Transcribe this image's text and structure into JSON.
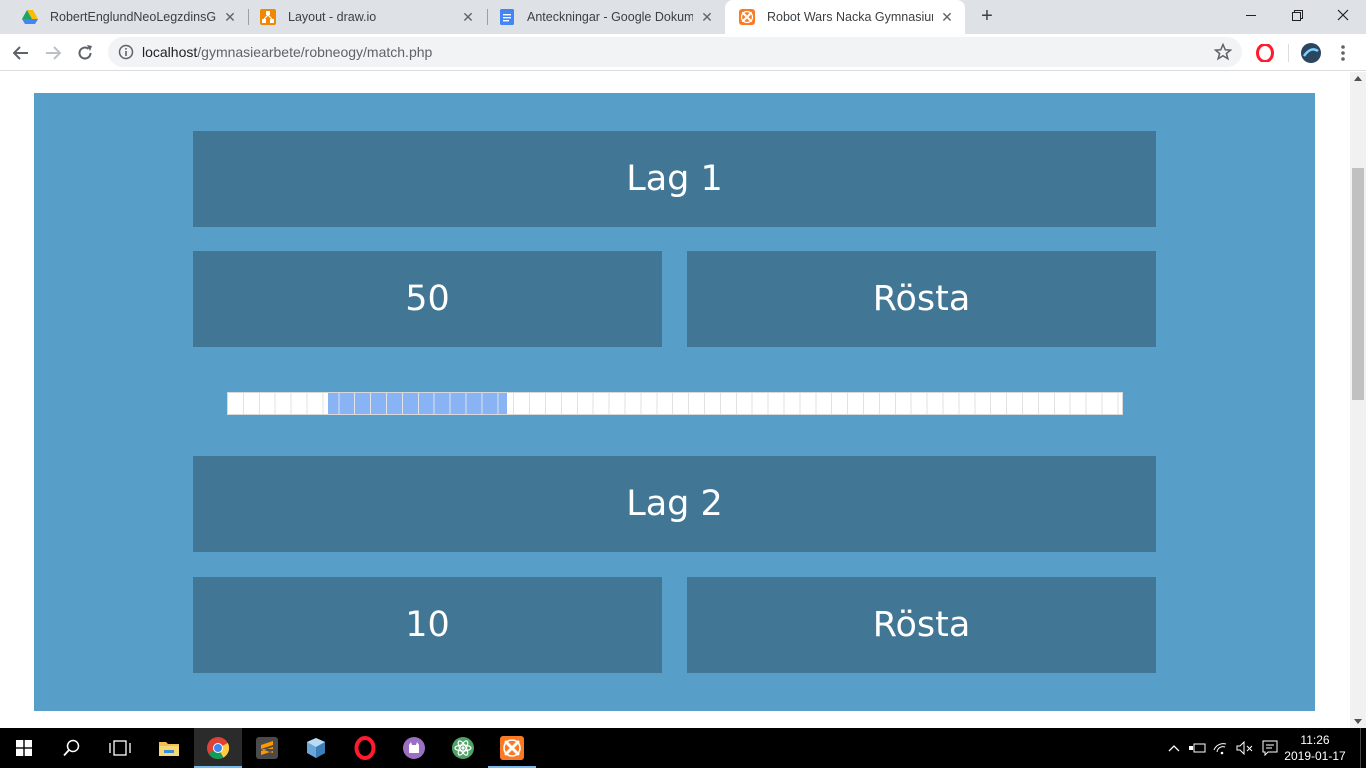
{
  "browser": {
    "tabs": [
      {
        "title": "RobertEnglundNeoLegzdinsGYAR",
        "favicon": "google-drive-icon"
      },
      {
        "title": "Layout - draw.io",
        "favicon": "drawio-icon"
      },
      {
        "title": "Anteckningar - Google Dokument",
        "favicon": "google-docs-icon"
      },
      {
        "title": "Robot Wars Nacka Gymnasium",
        "favicon": "xampp-icon",
        "active": true
      }
    ],
    "url_host": "localhost",
    "url_path": "/gymnasiearbete/robneogy/match.php"
  },
  "match": {
    "team1": {
      "name": "Lag 1",
      "score": "50",
      "vote_label": "Rösta"
    },
    "team2": {
      "name": "Lag 2",
      "score": "10",
      "vote_label": "Rösta"
    },
    "vote_bar": {
      "fill_start_fraction": 0.112,
      "fill_end_fraction": 0.312,
      "fill_color": "#88b3f5"
    }
  },
  "taskbar": {
    "apps": [
      "start-icon",
      "search-icon",
      "task-view-icon",
      "file-explorer-icon",
      "chrome-icon",
      "sublime-text-icon",
      "virtualbox-icon",
      "opera-icon",
      "github-desktop-icon",
      "atom-icon",
      "xampp-icon"
    ],
    "time": "11:26",
    "date": "2019-01-17"
  },
  "colors": {
    "panel": "#579fc8",
    "box": "#417694"
  }
}
